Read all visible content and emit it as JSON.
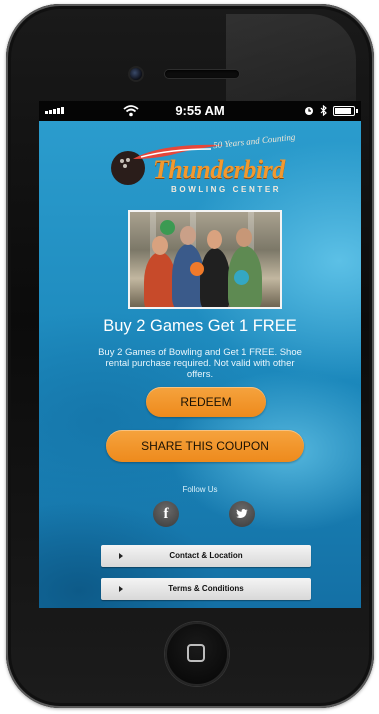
{
  "status_bar": {
    "time": "9:55 AM"
  },
  "logo": {
    "tagline": "50 Years and Counting",
    "name": "Thunderbird",
    "subtitle": "BOWLING CENTER"
  },
  "coupon": {
    "headline": "Buy 2 Games Get 1 FREE",
    "description": "Buy 2 Games of Bowling and Get 1 FREE. Shoe rental purchase required. Not valid with other offers.",
    "redeem_label": "REDEEM",
    "share_label": "SHARE THIS COUPON"
  },
  "social": {
    "follow_label": "Follow Us",
    "facebook_glyph": "f",
    "icons": [
      "facebook-icon",
      "twitter-icon"
    ]
  },
  "links": [
    {
      "label": "Contact & Location"
    },
    {
      "label": "Terms & Conditions"
    }
  ],
  "colors": {
    "accent_orange": "#ee8a1c",
    "background_blue": "#1c86b7",
    "phone_body": "#111111"
  }
}
